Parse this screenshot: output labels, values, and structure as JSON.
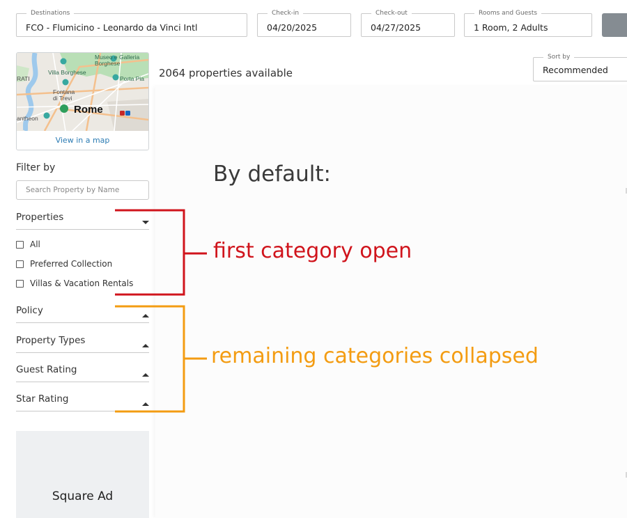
{
  "search": {
    "destination": {
      "label": "Destinations",
      "value": "FCO - Flumicino - Leonardo da Vinci Intl"
    },
    "checkin": {
      "label": "Check-in",
      "value": "04/20/2025"
    },
    "checkout": {
      "label": "Check-out",
      "value": "04/27/2025"
    },
    "rooms": {
      "label": "Rooms and Guests",
      "value": "1 Room, 2 Adults"
    }
  },
  "map": {
    "labels": {
      "museo1": "Museo e Galleria",
      "museo2": "Borghese",
      "villa": "Villa Borghese",
      "rati": "RATI",
      "porta": "Porta Pia",
      "fontana1": "Fontana",
      "fontana2": "di Trevi",
      "city": "Rome",
      "pantheon": "antheon"
    },
    "link_label": "View in a map"
  },
  "filter": {
    "title": "Filter by",
    "search_placeholder": "Search Property by Name",
    "categories": [
      {
        "label": "Properties",
        "open": true,
        "options": [
          "All",
          "Preferred Collection",
          "Villas & Vacation Rentals"
        ]
      },
      {
        "label": "Policy",
        "open": false
      },
      {
        "label": "Property Types",
        "open": false
      },
      {
        "label": "Guest Rating",
        "open": false
      },
      {
        "label": "Star Rating",
        "open": false
      }
    ]
  },
  "ad": {
    "label": "Square Ad"
  },
  "results": {
    "count_text": "2064 properties available"
  },
  "sort": {
    "label": "Sort by",
    "value": "Recommended"
  },
  "annotation": {
    "heading": "By default:",
    "first_note": "first category open",
    "second_note": "remaining categories collapsed",
    "colors": {
      "first": "#d0141c",
      "second": "#f39c12"
    }
  }
}
